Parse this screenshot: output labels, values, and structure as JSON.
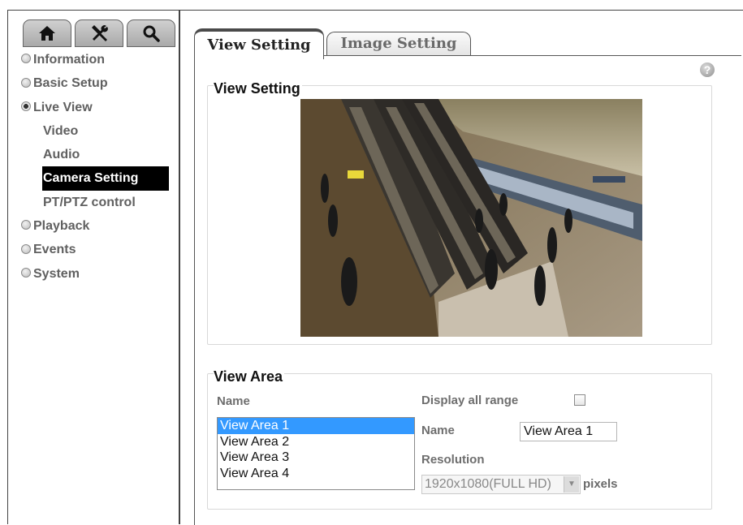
{
  "toolbar": {
    "icons": [
      "home-icon",
      "tools-icon",
      "search-icon"
    ]
  },
  "sidebar": {
    "items": [
      {
        "label": "Information"
      },
      {
        "label": "Basic Setup"
      },
      {
        "label": "Live View"
      },
      {
        "label": "Video"
      },
      {
        "label": "Audio"
      },
      {
        "label": "Camera Setting"
      },
      {
        "label": "PT/PTZ control"
      },
      {
        "label": "Playback"
      },
      {
        "label": "Events"
      },
      {
        "label": "System"
      }
    ]
  },
  "tabs": [
    {
      "label": "View Setting"
    },
    {
      "label": "Image Setting"
    }
  ],
  "view_setting": {
    "legend": "View Setting"
  },
  "view_area": {
    "legend": "View Area",
    "name_label": "Name",
    "list": [
      "View Area 1",
      "View Area 2",
      "View Area 3",
      "View Area 4"
    ],
    "selected_index": 0,
    "display_all_label": "Display all range",
    "display_all_checked": false,
    "name_field_label": "Name",
    "name_value": "View Area 1",
    "resolution_label": "Resolution",
    "resolution_value": "1920x1080(FULL HD)",
    "resolution_unit": "pixels"
  },
  "colors": {
    "selected_bg": "#000000",
    "list_highlight": "#3399ff"
  }
}
